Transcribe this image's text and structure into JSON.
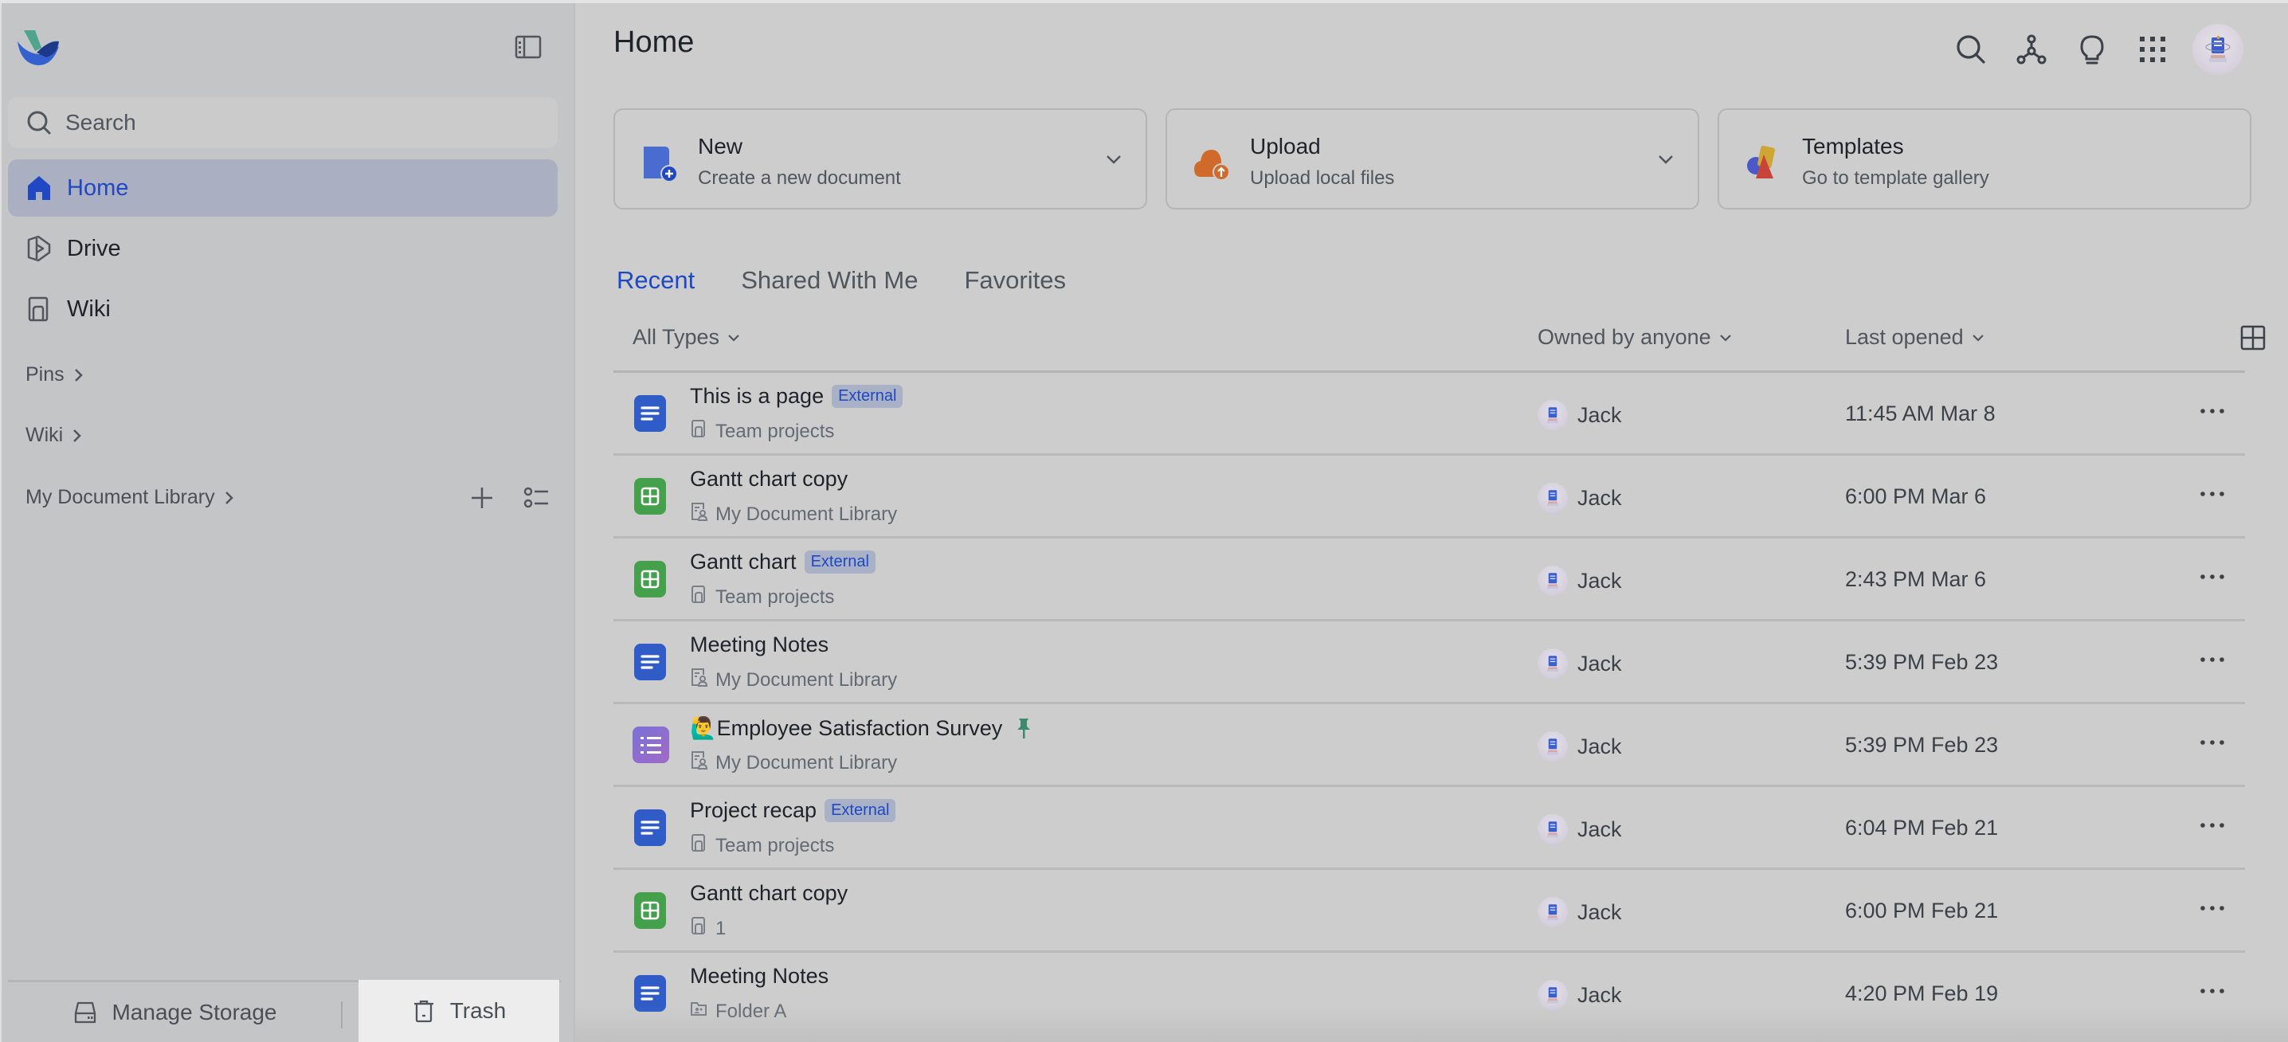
{
  "app": {
    "brand_colors": {
      "accent": "#1e48c4",
      "doc": "#2f5cc7",
      "sheet": "#45a04b",
      "form": "#8a6dd0",
      "upload": "#d06a2a",
      "pin": "#3a8a6e"
    }
  },
  "sidebar": {
    "search_placeholder": "Search",
    "nav": [
      {
        "label": "Home",
        "icon": "home-icon",
        "active": true
      },
      {
        "label": "Drive",
        "icon": "drive-icon",
        "active": false
      },
      {
        "label": "Wiki",
        "icon": "wiki-icon",
        "active": false
      }
    ],
    "sections": [
      {
        "label": "Pins"
      },
      {
        "label": "Wiki"
      },
      {
        "label": "My Document Library"
      }
    ],
    "footer": {
      "manage_storage": "Manage Storage",
      "trash": "Trash"
    }
  },
  "header": {
    "title": "Home"
  },
  "cards": [
    {
      "title": "New",
      "subtitle": "Create a new document",
      "has_dropdown": true
    },
    {
      "title": "Upload",
      "subtitle": "Upload local files",
      "has_dropdown": true
    },
    {
      "title": "Templates",
      "subtitle": "Go to template gallery",
      "has_dropdown": false
    }
  ],
  "tabs": [
    {
      "label": "Recent",
      "active": true
    },
    {
      "label": "Shared With Me",
      "active": false
    },
    {
      "label": "Favorites",
      "active": false
    }
  ],
  "table": {
    "filters": {
      "type": "All Types",
      "owner": "Owned by anyone",
      "sort": "Last opened"
    },
    "rows": [
      {
        "type": "doc",
        "name": "This is a page",
        "badge": "External",
        "pinned": false,
        "location_icon": "wiki",
        "location": "Team projects",
        "owner": "Jack",
        "opened": "11:45 AM Mar 8"
      },
      {
        "type": "sheet",
        "name": "Gantt chart copy",
        "badge": "",
        "pinned": false,
        "location_icon": "library",
        "location": "My Document Library",
        "owner": "Jack",
        "opened": "6:00 PM Mar 6"
      },
      {
        "type": "sheet",
        "name": "Gantt chart",
        "badge": "External",
        "pinned": false,
        "location_icon": "wiki",
        "location": "Team projects",
        "owner": "Jack",
        "opened": "2:43 PM Mar 6"
      },
      {
        "type": "doc",
        "name": "Meeting Notes",
        "badge": "",
        "pinned": false,
        "location_icon": "library",
        "location": "My Document Library",
        "owner": "Jack",
        "opened": "5:39 PM Feb 23"
      },
      {
        "type": "form",
        "name": "🙋‍♂️Employee Satisfaction Survey",
        "badge": "",
        "pinned": true,
        "location_icon": "library",
        "location": "My Document Library",
        "owner": "Jack",
        "opened": "5:39 PM Feb 23"
      },
      {
        "type": "doc",
        "name": "Project recap",
        "badge": "External",
        "pinned": false,
        "location_icon": "wiki",
        "location": "Team projects",
        "owner": "Jack",
        "opened": "6:04 PM Feb 21"
      },
      {
        "type": "sheet",
        "name": "Gantt chart copy",
        "badge": "",
        "pinned": false,
        "location_icon": "wiki",
        "location": "1",
        "owner": "Jack",
        "opened": "6:00 PM Feb 21"
      },
      {
        "type": "doc",
        "name": "Meeting Notes",
        "badge": "",
        "pinned": false,
        "location_icon": "folder",
        "location": "Folder A",
        "owner": "Jack",
        "opened": "4:20 PM Feb 19"
      }
    ]
  }
}
